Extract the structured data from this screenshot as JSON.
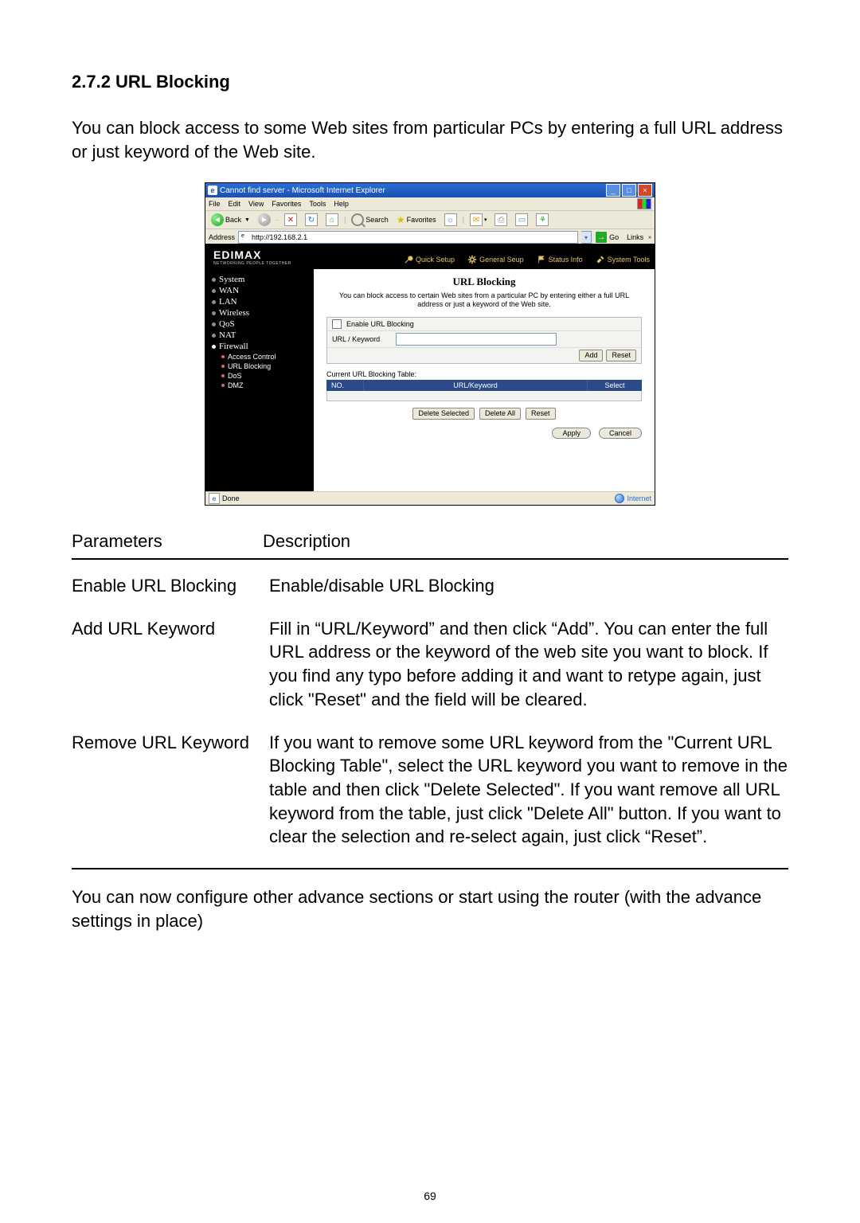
{
  "section_title": "2.7.2 URL Blocking",
  "intro": "You can block access to some Web sites from particular PCs by entering a full URL address or just keyword of the Web site.",
  "ie": {
    "title": "Cannot find server - Microsoft Internet Explorer",
    "menus": [
      "File",
      "Edit",
      "View",
      "Favorites",
      "Tools",
      "Help"
    ],
    "toolbar": {
      "back": "Back",
      "search": "Search",
      "favorites": "Favorites"
    },
    "address_label": "Address",
    "address_value": "http://192.168.2.1",
    "go": "Go",
    "links": "Links",
    "status_done": "Done",
    "status_zone": "Internet"
  },
  "router": {
    "brand_main": "EDIMAX",
    "brand_sub": "NETWORKING PEOPLE TOGETHER",
    "tabs": [
      "Quick Setup",
      "General Seup",
      "Status Info",
      "System Tools"
    ],
    "sidenav": {
      "main": [
        "System",
        "WAN",
        "LAN",
        "Wireless",
        "QoS",
        "NAT",
        "Firewall"
      ],
      "sub": [
        "Access Control",
        "URL Blocking",
        "DoS",
        "DMZ"
      ]
    },
    "content": {
      "title": "URL Blocking",
      "desc": "You can block access to certain Web sites from a particular PC by entering either a full URL address or just a keyword of the Web site.",
      "enable_label": "Enable URL Blocking",
      "keyword_label": "URL / Keyword",
      "add_btn": "Add",
      "reset_btn": "Reset",
      "table_label": "Current URL Blocking Table:",
      "th_no": "NO.",
      "th_url": "URL/Keyword",
      "th_select": "Select",
      "del_sel": "Delete Selected",
      "del_all": "Delete All",
      "reset2": "Reset",
      "apply": "Apply",
      "cancel": "Cancel"
    }
  },
  "params": {
    "header_left": "Parameters",
    "header_right": "Description",
    "rows": [
      {
        "name": "Enable URL Blocking",
        "desc": "Enable/disable URL Blocking"
      },
      {
        "name": "Add URL Keyword",
        "desc": "Fill in “URL/Keyword” and then click “Add”. You can enter the full URL address or the keyword of the web site you want to block. If you find any typo before adding it and want to retype again, just click \"Reset\" and the field will be cleared."
      },
      {
        "name": "Remove URL Keyword",
        "desc": "If you want to remove some URL keyword from the \"Current URL Blocking Table\", select the URL keyword you want to remove in the table and then click \"Delete Selected\". If you want remove all URL keyword from the table, just click \"Delete All\" button. If you want to clear the selection and re-select again, just click “Reset”."
      }
    ]
  },
  "outro": "You can now configure other advance sections or start using the router (with the advance settings in place)",
  "page_number": "69"
}
